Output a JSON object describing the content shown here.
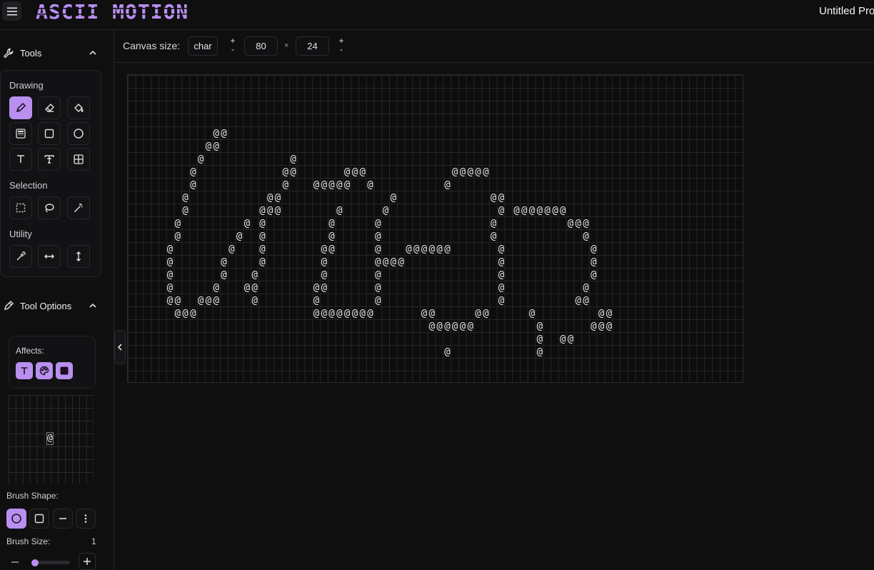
{
  "app": {
    "title": "Untitled Pro"
  },
  "logo": {
    "text": "ASCII MOTION",
    "color": "#b98ff0"
  },
  "sidebar": {
    "tools_section": {
      "label": "Tools"
    },
    "groups": {
      "drawing": "Drawing",
      "selection": "Selection",
      "utility": "Utility"
    },
    "drawing_tools": [
      "pencil-icon",
      "eraser-icon",
      "paint-bucket-icon",
      "gradient-fill-icon",
      "rectangle-icon",
      "ellipse-icon",
      "text-icon",
      "text-style-icon",
      "grid-icon"
    ],
    "selection_tools": [
      "rect-select-icon",
      "lasso-icon",
      "magic-wand-icon"
    ],
    "utility_tools": [
      "eyedropper-icon",
      "flip-horizontal-icon",
      "flip-vertical-icon"
    ],
    "active_tool": "pencil-icon",
    "tool_options": {
      "label": "Tool Options",
      "affects_label": "Affects:",
      "affects": [
        "text-icon",
        "palette-icon",
        "square-icon"
      ],
      "brush_char": "@",
      "brush_shape_label": "Brush Shape:",
      "brush_shapes": [
        "circle-icon",
        "square-icon",
        "line-icon",
        "more-vertical-icon"
      ],
      "brush_size_label": "Brush Size:",
      "brush_size": "1"
    }
  },
  "canvas_bar": {
    "label": "Canvas size:",
    "unit": "char",
    "width": "80",
    "height": "24",
    "times": "×",
    "plus": "+",
    "minus": "-"
  },
  "accent": "#b98ff0",
  "canvas": {
    "cols": 80,
    "rows": 24,
    "char": "@",
    "lines": [
      "",
      "",
      "",
      "",
      "           @@",
      "          @@",
      "         @           @",
      "        @           @@      @@@           @@@@@",
      "        @           @   @@@@@  @         @",
      "       @          @@              @            @@",
      "       @         @@@       @     @              @ @@@@@@@",
      "      @        @ @        @     @              @         @@@",
      "      @       @  @        @     @              @           @",
      "     @       @   @       @@     @   @@@@@@      @           @",
      "     @      @    @       @      @@@@            @           @",
      "     @      @   @        @      @               @           @",
      "     @     @   @@       @@      @               @          @",
      "     @@  @@@    @       @       @               @         @@",
      "      @@@               @@@@@@@@      @@     @@     @        @@",
      "                                       @@@@@@        @      @@@",
      "                                                     @  @@",
      "                                         @           @",
      "",
      ""
    ]
  }
}
